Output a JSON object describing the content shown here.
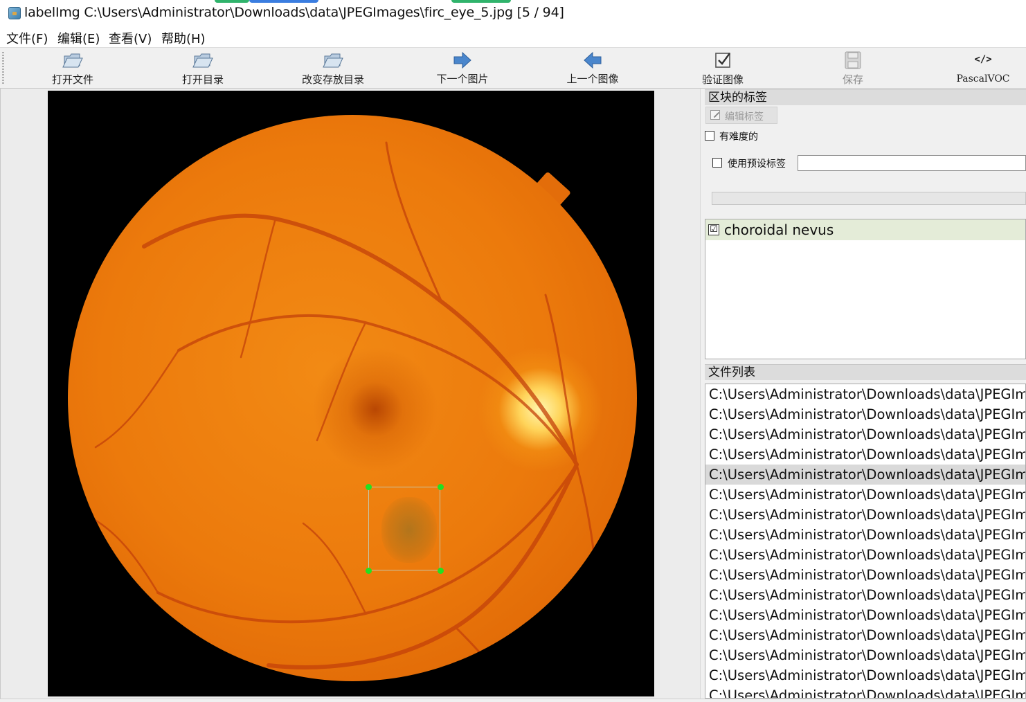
{
  "window": {
    "title": "labelImg C:\\Users\\Administrator\\Downloads\\data\\JPEGImages\\firc_eye_5.jpg [5 / 94]"
  },
  "menu": [
    "文件(F)",
    "编辑(E)",
    "查看(V)",
    "帮助(H)"
  ],
  "toolbar": {
    "open_file": "打开文件",
    "open_dir": "打开目录",
    "change_save_dir": "改变存放目录",
    "next_image": "下一个图片",
    "prev_image": "上一个图像",
    "verify_image": "验证图像",
    "save": "保存",
    "format": "PascalVOC",
    "format_icon_text": "</>"
  },
  "colors": {
    "handle": "#22e022",
    "selected_label_bg": "#e4ecd8",
    "selected_file_bg": "#d9d9d9",
    "arrow_blue": "#3f7fc8"
  },
  "label_dock": {
    "title": "区块的标签",
    "edit_label_button": "编辑标签",
    "difficult_checkbox": "有难度的",
    "difficult_checked": false,
    "use_preset_checkbox": "使用预设标签",
    "use_preset_checked": false,
    "preset_value": "",
    "labels": [
      {
        "name": "choroidal nevus",
        "checked": true,
        "check_glyph": "☑"
      }
    ]
  },
  "file_dock": {
    "title": "文件列表",
    "files": [
      "C:\\Users\\Administrator\\Downloads\\data\\JPEGIm",
      "C:\\Users\\Administrator\\Downloads\\data\\JPEGIm",
      "C:\\Users\\Administrator\\Downloads\\data\\JPEGIm",
      "C:\\Users\\Administrator\\Downloads\\data\\JPEGIm",
      "C:\\Users\\Administrator\\Downloads\\data\\JPEGIm",
      "C:\\Users\\Administrator\\Downloads\\data\\JPEGIm",
      "C:\\Users\\Administrator\\Downloads\\data\\JPEGIm",
      "C:\\Users\\Administrator\\Downloads\\data\\JPEGIm",
      "C:\\Users\\Administrator\\Downloads\\data\\JPEGIm",
      "C:\\Users\\Administrator\\Downloads\\data\\JPEGIm",
      "C:\\Users\\Administrator\\Downloads\\data\\JPEGIm",
      "C:\\Users\\Administrator\\Downloads\\data\\JPEGIm",
      "C:\\Users\\Administrator\\Downloads\\data\\JPEGIm",
      "C:\\Users\\Administrator\\Downloads\\data\\JPEGIm",
      "C:\\Users\\Administrator\\Downloads\\data\\JPEGIm",
      "C:\\Users\\Administrator\\Downloads\\data\\JPEGIm"
    ],
    "selected_index": 4
  }
}
